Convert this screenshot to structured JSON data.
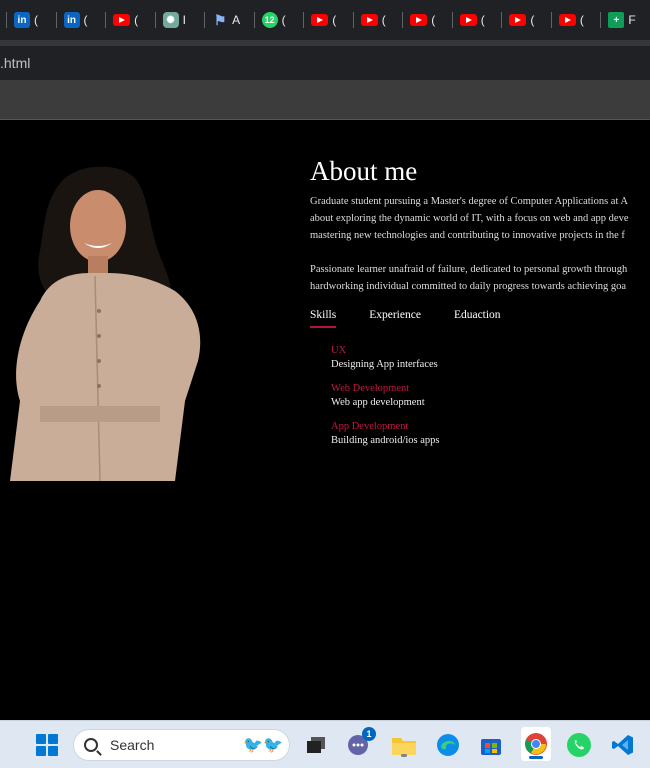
{
  "browser": {
    "tabs": [
      {
        "icon": "linkedin-icon",
        "label": "(",
        "fav": "li",
        "glyph": "in"
      },
      {
        "icon": "linkedin-icon",
        "label": "(",
        "fav": "li",
        "glyph": "in"
      },
      {
        "icon": "youtube-icon",
        "label": "(",
        "fav": "yt",
        "glyph": ""
      },
      {
        "icon": "chatgpt-icon",
        "label": "I",
        "fav": "gpt",
        "glyph": "✺"
      },
      {
        "icon": "flag-icon",
        "label": "A",
        "fav": "flag",
        "glyph": "⚑"
      },
      {
        "icon": "whatsapp-icon",
        "label": "(",
        "fav": "wa",
        "glyph": "12"
      },
      {
        "icon": "youtube-icon",
        "label": "(",
        "fav": "yt",
        "glyph": ""
      },
      {
        "icon": "youtube-icon",
        "label": "(",
        "fav": "yt",
        "glyph": ""
      },
      {
        "icon": "youtube-icon",
        "label": "(",
        "fav": "yt",
        "glyph": ""
      },
      {
        "icon": "youtube-icon",
        "label": "(",
        "fav": "yt",
        "glyph": ""
      },
      {
        "icon": "youtube-icon",
        "label": "(",
        "fav": "yt",
        "glyph": ""
      },
      {
        "icon": "youtube-icon",
        "label": "(",
        "fav": "yt",
        "glyph": ""
      },
      {
        "icon": "sheets-icon",
        "label": "F",
        "fav": "sheet",
        "glyph": "+"
      }
    ],
    "url": ".html"
  },
  "about": {
    "title": "About me",
    "p1_lines": [
      "Graduate student pursuing a Master's degree of Computer Applications at A",
      "about exploring the dynamic world of IT, with a focus on web and app deve",
      "mastering new technologies and contributing to innovative projects in the f"
    ],
    "p2_lines": [
      "Passionate learner unafraid of failure, dedicated to personal growth through",
      "hardworking individual committed to daily progress towards achieving goa"
    ],
    "tabs": [
      "Skills",
      "Experience",
      "Eduaction"
    ],
    "skills": [
      {
        "title": "UX",
        "desc": "Designing App interfaces"
      },
      {
        "title": "Web Development",
        "desc": "Web app development"
      },
      {
        "title": "App Development",
        "desc": "Building android/ios apps"
      }
    ]
  },
  "taskbar": {
    "search_placeholder": "Search",
    "chat_badge": "1",
    "accent": "#0078d4"
  },
  "colors": {
    "accent_red": "#c01843",
    "page_bg": "#000000"
  }
}
